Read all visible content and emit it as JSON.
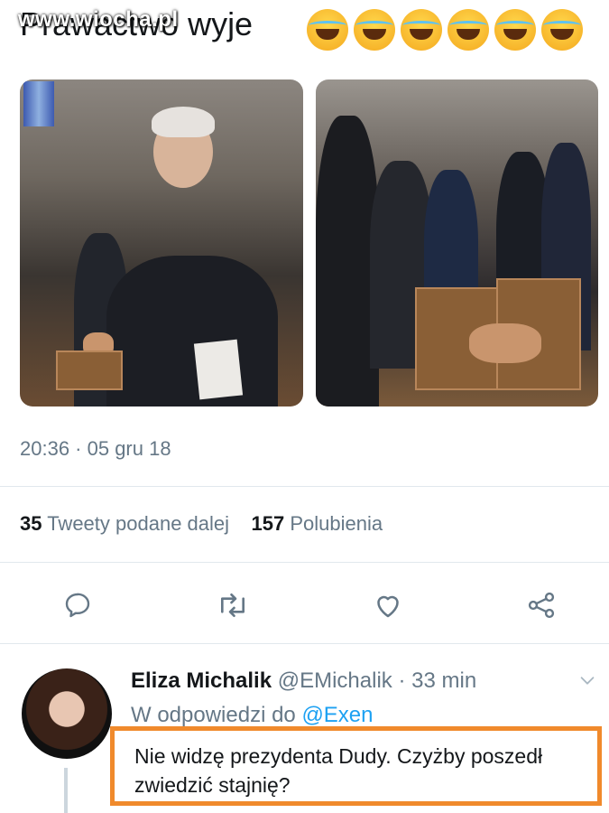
{
  "watermark": "www.wiocha.pl",
  "tweet": {
    "text": "Prawactwo wyje",
    "emoji_count": 6,
    "timestamp": "20:36 · 05 gru 18",
    "retweets_count": "35",
    "retweets_label": "Tweety podane dalej",
    "likes_count": "157",
    "likes_label": "Polubienia"
  },
  "icons": {
    "reply": "reply-icon",
    "retweet": "retweet-icon",
    "like": "heart-icon",
    "share": "share-icon",
    "menu": "chevron-down-icon"
  },
  "reply": {
    "name": "Eliza Michalik",
    "handle": "@EMichalik",
    "time": "· 33 min",
    "in_reply_prefix": "W odpowiedzi do",
    "in_reply_mention": "@Exen",
    "text": "Nie widzę prezydenta Dudy. Czyżby poszedł zwiedzić stajnię?"
  },
  "colors": {
    "accent": "#1da1f2",
    "highlight": "#f08a2c",
    "secondary_text": "#657786"
  }
}
